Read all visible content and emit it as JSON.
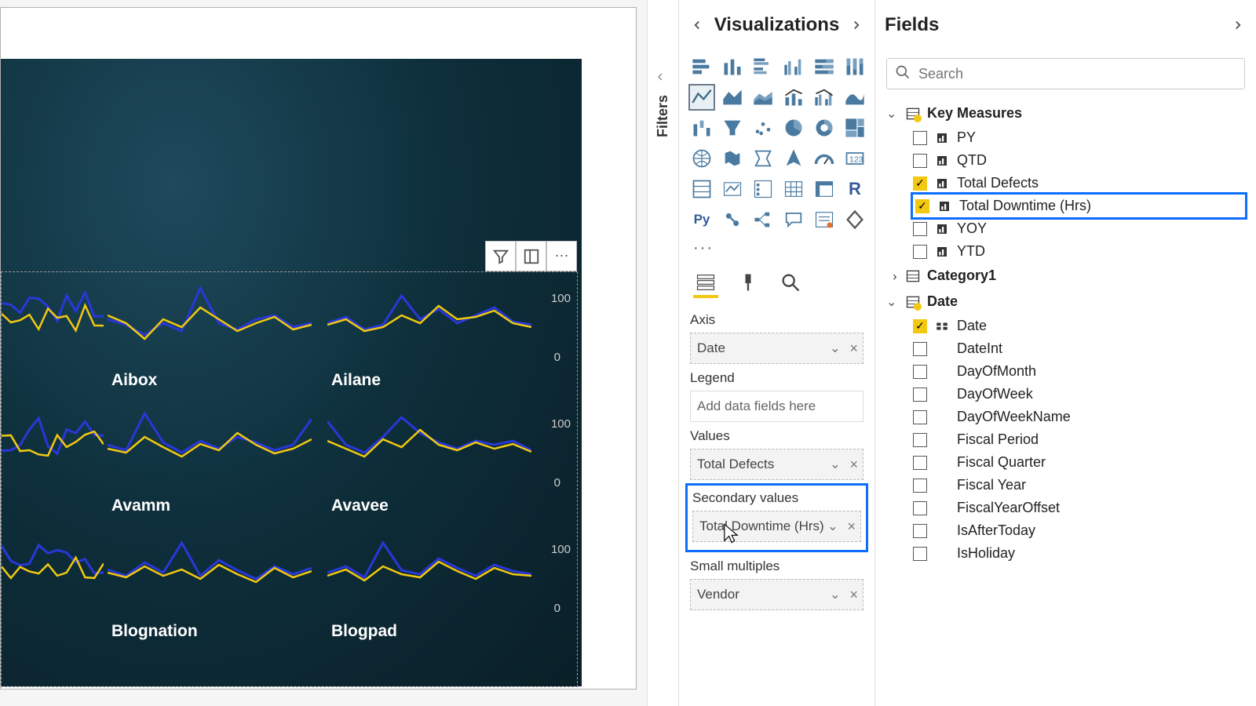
{
  "filters_pane_label": "Filters",
  "viz_pane": {
    "title": "Visualizations",
    "more": "···",
    "tabs": {
      "fields": "fields",
      "format": "format",
      "analytics": "analytics"
    },
    "wells": {
      "axis_label": "Axis",
      "axis_value": "Date",
      "legend_label": "Legend",
      "legend_placeholder": "Add data fields here",
      "values_label": "Values",
      "values_value": "Total Defects",
      "secondary_label": "Secondary values",
      "secondary_value": "Total Downtime (Hrs)",
      "small_mult_label": "Small multiples",
      "small_mult_value": "Vendor"
    }
  },
  "fields_pane": {
    "title": "Fields",
    "search_placeholder": "Search",
    "groups": {
      "key_measures": {
        "label": "Key Measures",
        "items": [
          {
            "label": "PY",
            "checked": false,
            "type": "measure"
          },
          {
            "label": "QTD",
            "checked": false,
            "type": "measure"
          },
          {
            "label": "Total Defects",
            "checked": true,
            "type": "measure"
          },
          {
            "label": "Total Downtime (Hrs)",
            "checked": true,
            "type": "measure",
            "highlight": true
          },
          {
            "label": "YOY",
            "checked": false,
            "type": "measure"
          },
          {
            "label": "YTD",
            "checked": false,
            "type": "measure"
          }
        ]
      },
      "category1": {
        "label": "Category1"
      },
      "date": {
        "label": "Date",
        "items": [
          {
            "label": "Date",
            "checked": true,
            "type": "hierarchy"
          },
          {
            "label": "DateInt",
            "checked": false,
            "type": "column"
          },
          {
            "label": "DayOfMonth",
            "checked": false,
            "type": "column"
          },
          {
            "label": "DayOfWeek",
            "checked": false,
            "type": "column"
          },
          {
            "label": "DayOfWeekName",
            "checked": false,
            "type": "column"
          },
          {
            "label": "Fiscal Period",
            "checked": false,
            "type": "column"
          },
          {
            "label": "Fiscal Quarter",
            "checked": false,
            "type": "column"
          },
          {
            "label": "Fiscal Year",
            "checked": false,
            "type": "column"
          },
          {
            "label": "FiscalYearOffset",
            "checked": false,
            "type": "column"
          },
          {
            "label": "IsAfterToday",
            "checked": false,
            "type": "column"
          },
          {
            "label": "IsHoliday",
            "checked": false,
            "type": "column"
          }
        ]
      }
    }
  },
  "small_multiples": {
    "labels": [
      "",
      "Aibox",
      "Ailane",
      "",
      "Avamm",
      "Avavee",
      "",
      "Blognation",
      "Blogpad"
    ],
    "axis_100": "100",
    "axis_0": "0"
  },
  "toolbar": {
    "filter": "filter",
    "focus": "focus",
    "more": "⋯"
  },
  "chart_data": {
    "type": "line",
    "note": "Small-multiples line/combo charts; two series (Total Defects yellow, Total Downtime blue) per vendor over Date. Values estimated from pixels.",
    "ylim": [
      0,
      100
    ],
    "vendors": [
      {
        "name": "Aibox",
        "defects": [
          60,
          50,
          30,
          55,
          45,
          70,
          55,
          40,
          50,
          58,
          42,
          48
        ],
        "downtime": [
          55,
          48,
          35,
          50,
          40,
          95,
          50,
          42,
          55,
          60,
          45,
          50
        ]
      },
      {
        "name": "Ailane",
        "defects": [
          48,
          55,
          40,
          45,
          60,
          50,
          72,
          55,
          58,
          66,
          50,
          45
        ],
        "downtime": [
          50,
          58,
          42,
          48,
          85,
          55,
          68,
          50,
          60,
          70,
          52,
          48
        ]
      },
      {
        "name": "Avamm",
        "defects": [
          50,
          45,
          65,
          52,
          40,
          56,
          48,
          70,
          55,
          44,
          50,
          62
        ],
        "downtime": [
          55,
          48,
          95,
          58,
          45,
          60,
          50,
          65,
          58,
          48,
          55,
          88
        ]
      },
      {
        "name": "Avavee",
        "defects": [
          60,
          50,
          40,
          62,
          52,
          74,
          55,
          48,
          58,
          50,
          56,
          46
        ],
        "downtime": [
          85,
          55,
          45,
          65,
          90,
          70,
          58,
          50,
          60,
          55,
          60,
          48
        ]
      },
      {
        "name": "Blognation",
        "defects": [
          52,
          46,
          60,
          48,
          56,
          44,
          62,
          50,
          40,
          58,
          46,
          54
        ],
        "downtime": [
          56,
          48,
          65,
          52,
          90,
          48,
          68,
          55,
          44,
          60,
          50,
          58
        ]
      },
      {
        "name": "Blogpad",
        "defects": [
          48,
          56,
          42,
          60,
          50,
          46,
          66,
          54,
          44,
          58,
          50,
          48
        ],
        "downtime": [
          52,
          60,
          46,
          90,
          55,
          50,
          70,
          58,
          48,
          62,
          54,
          50
        ]
      }
    ]
  }
}
